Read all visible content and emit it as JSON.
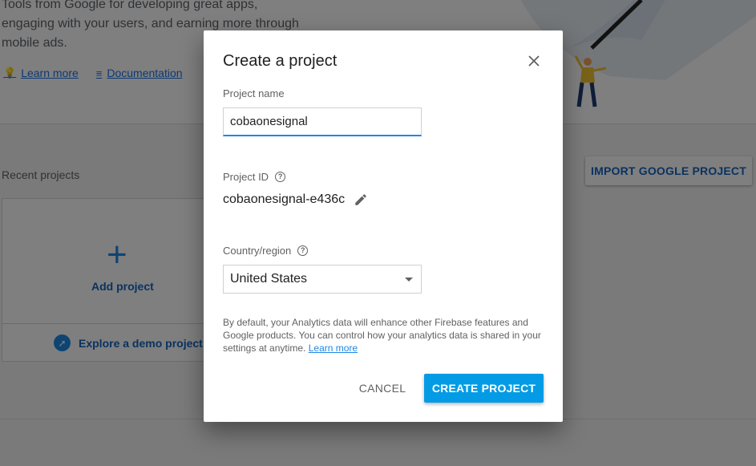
{
  "background": {
    "hero_text": "Tools from Google for developing great apps, engaging with your users, and earning more through mobile ads.",
    "links": [
      {
        "label": "Learn more",
        "icon": "lightbulb-icon"
      },
      {
        "label": "Documentation",
        "icon": "notes-icon"
      }
    ],
    "recent_projects_label": "Recent projects",
    "add_project_label": "Add project",
    "explore_demo_label": "Explore a demo project",
    "import_button_label": "IMPORT GOOGLE PROJECT"
  },
  "dialog": {
    "title": "Create a project",
    "close_icon": "close-icon",
    "project_name": {
      "label": "Project name",
      "value": "cobaonesignal"
    },
    "project_id": {
      "label": "Project ID",
      "value": "cobaonesignal-e436c",
      "edit_icon": "pencil-icon"
    },
    "country": {
      "label": "Country/region",
      "value": "United States"
    },
    "notice": {
      "text": "By default, your Analytics data will enhance other Firebase features and Google products. You can control how your analytics data is shared in your settings at anytime.",
      "link": "Learn more"
    },
    "cancel_label": "CANCEL",
    "create_label": "CREATE PROJECT"
  },
  "colors": {
    "primary": "#039be5",
    "link": "#1e88e5",
    "scrim": "rgba(0,0,0,0.5)"
  }
}
